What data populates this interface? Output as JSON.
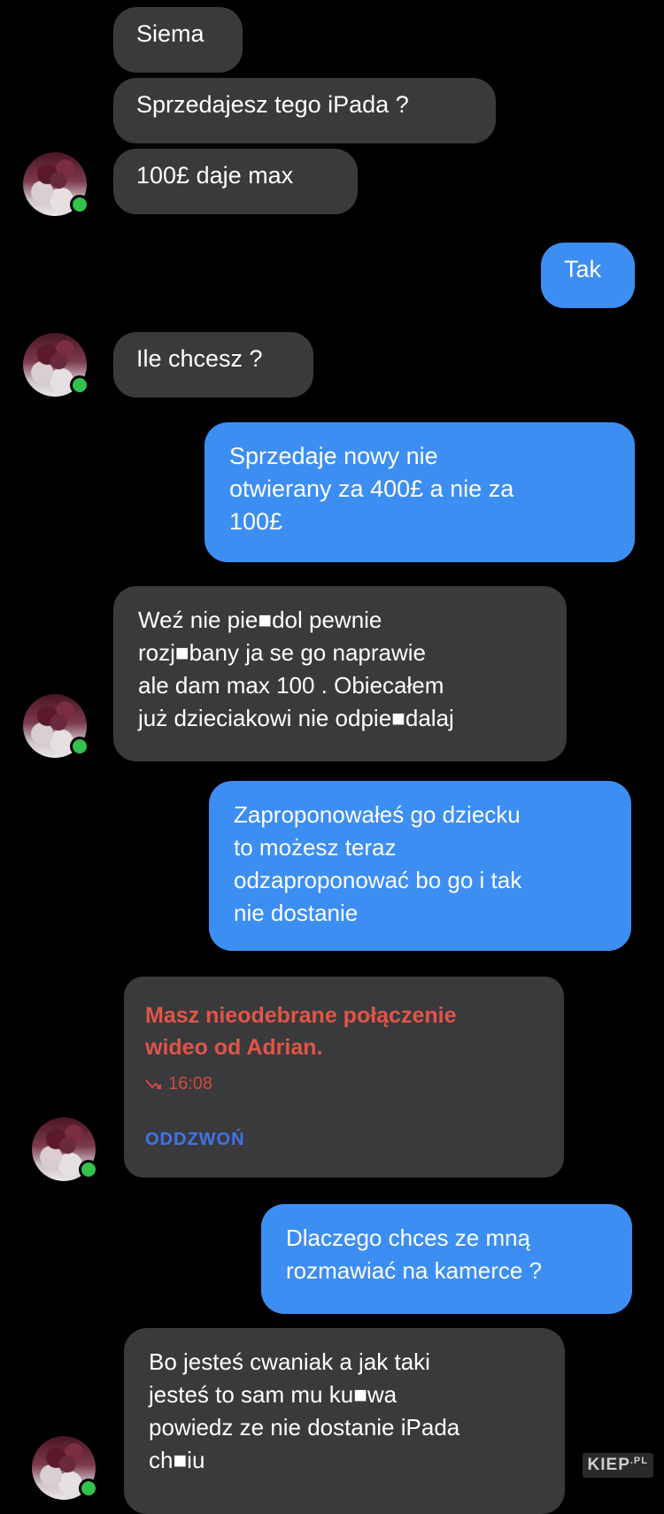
{
  "messages": [
    {
      "dir": "in",
      "text": "Siema"
    },
    {
      "dir": "in",
      "text": "Sprzedajesz tego iPada ?"
    },
    {
      "dir": "in",
      "text": "100£ daje max"
    },
    {
      "dir": "out",
      "text": "Tak"
    },
    {
      "dir": "in",
      "text": "Ile chcesz ?"
    },
    {
      "dir": "out",
      "text": "Sprzedaje nowy nie\notwierany za 400£ a nie za\n100£"
    },
    {
      "dir": "in",
      "text": "Weź nie pie■dol pewnie\nrozj■bany ja se go naprawie\nale dam max 100 . Obiecałem\njuż dzieciakowi nie odpie■dalaj"
    },
    {
      "dir": "out",
      "text": "Zaproponowałeś go dziecku\nto możesz teraz\nodzaproponować bo go i tak\nnie dostanie"
    },
    {
      "dir": "out",
      "text": "Dlaczego chces ze mną\nrozmawiać na kamerce ?"
    },
    {
      "dir": "in",
      "text": "Bo jesteś cwaniak a jak taki\njesteś to sam mu ku■wa\npowiedz ze nie dostanie iPada\nch■iu"
    }
  ],
  "missed_call": {
    "title": "Masz nieodebrane połączenie\nwideo od Adrian.",
    "time": "16:08",
    "callback_label": "ODDZWOŃ"
  },
  "watermark": {
    "main": "KIEP",
    "suffix": ".PL"
  },
  "colors": {
    "incoming_bubble": "#3a3a3c",
    "outgoing_bubble": "#3d8ef3",
    "missed_call_text": "#e0554a",
    "callback_link": "#3f74e8",
    "online_indicator": "#32c24d"
  },
  "icons": [
    "contact-avatar",
    "online-status-dot",
    "missed-call-icon"
  ]
}
